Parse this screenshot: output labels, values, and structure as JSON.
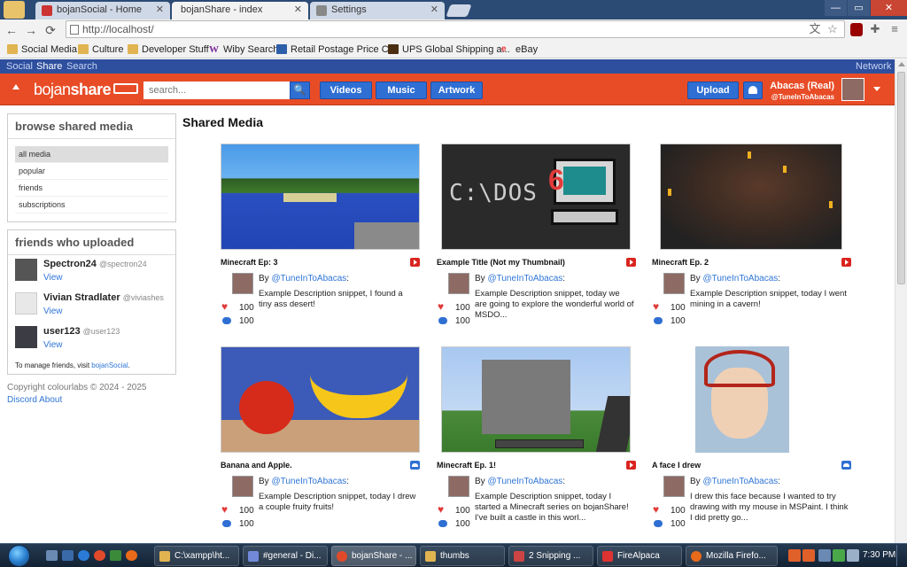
{
  "browser": {
    "tabs": [
      {
        "label": "bojanSocial - Home",
        "close": "✕"
      },
      {
        "label": "bojanShare - index",
        "close": "✕"
      },
      {
        "label": "Settings",
        "close": "✕"
      }
    ],
    "url": "http://localhost/",
    "bookmarks": [
      {
        "label": "Social Media",
        "icon": "folder-icon"
      },
      {
        "label": "Culture",
        "icon": "folder-icon"
      },
      {
        "label": "Developer Stuff",
        "icon": "folder-icon"
      },
      {
        "label": "Wiby Search",
        "icon": "wiby-icon"
      },
      {
        "label": "Retail Postage Price C...",
        "icon": "usps-icon"
      },
      {
        "label": "UPS Global Shipping a...",
        "icon": "ups-icon"
      },
      {
        "label": "eBay",
        "icon": "ebay-icon"
      }
    ],
    "window_controls": {
      "minimize": "—",
      "maximize": "▭",
      "close": "✕"
    },
    "nav": {
      "back": "←",
      "forward": "→",
      "reload": "⟳"
    }
  },
  "network_bar": {
    "social": "Social",
    "share": "Share",
    "search": "Search",
    "network": "Network"
  },
  "header": {
    "logo_light": "bojan",
    "logo_bold": "share",
    "search_placeholder": "search...",
    "search_icon": "🔍",
    "nav": [
      "Videos",
      "Music",
      "Artwork"
    ],
    "upload": "Upload",
    "user_name": "Abacas (Real)",
    "user_handle": "@TuneInToAbacas",
    "accent": "#e84c26",
    "button_blue": "#2f6fd3"
  },
  "sidebar": {
    "browse_title": "browse shared media",
    "browse_items": [
      "all media",
      "popular",
      "friends",
      "subscriptions"
    ],
    "friends_title": "friends who uploaded",
    "friends": [
      {
        "name": "Spectron24",
        "handle": "@spectron24",
        "view": "View"
      },
      {
        "name": "Vivian Stradlater",
        "handle": "@viviashes",
        "view": "View"
      },
      {
        "name": "user123",
        "handle": "@user123",
        "view": "View"
      }
    ],
    "manage_text": "To manage friends, visit ",
    "manage_link": "bojanSocial",
    "manage_end": ".",
    "copyright": "Copyright colourlabs © 2024 - 2025",
    "footer_links": [
      "Discord",
      "About"
    ]
  },
  "main": {
    "title": "Shared Media",
    "items": [
      {
        "title": "Minecraft Ep: 3",
        "type": "video",
        "by": "By ",
        "author": "@TuneInToAbacas",
        "colon": ":",
        "desc": "Example Description snippet, I found a tiny ass desert!",
        "likes": "100",
        "comments": "100",
        "heart": "♥"
      },
      {
        "title": "Example Title (Not my Thumbnail)",
        "type": "video",
        "by": "By ",
        "author": "@TuneInToAbacas",
        "colon": ":",
        "desc": "Example Description snippet, today we are going to explore the wonderful world of MSDO...",
        "likes": "100",
        "comments": "100",
        "heart": "♥",
        "thumb_text": "C:\\DOS",
        "thumb_badge": "6"
      },
      {
        "title": "Minecraft Ep. 2",
        "type": "video",
        "by": "By ",
        "author": "@TuneInToAbacas",
        "colon": ":",
        "desc": "Example Description snippet, today I went mining in a cavern!",
        "likes": "100",
        "comments": "100",
        "heart": "♥"
      },
      {
        "title": "Banana and Apple.",
        "type": "artwork",
        "by": "By ",
        "author": "@TuneInToAbacas",
        "colon": ":",
        "desc": "Example Description snippet, today I drew a couple fruity fruits!",
        "likes": "100",
        "comments": "100",
        "heart": "♥"
      },
      {
        "title": "Minecraft Ep. 1!",
        "type": "video",
        "by": "By ",
        "author": "@TuneInToAbacas",
        "colon": ":",
        "desc": "Example Description snippet, today I started a Minecraft series on bojanShare! I've built a castle in this worl...",
        "likes": "100",
        "comments": "100",
        "heart": "♥"
      },
      {
        "title": "A face I drew",
        "type": "artwork",
        "by": "By ",
        "author": "@TuneInToAbacas",
        "colon": ":",
        "desc": "I drew this face because I wanted to try drawing with my mouse in MSPaint. I think I did pretty go...",
        "likes": "100",
        "comments": "100",
        "heart": "♥"
      }
    ]
  },
  "taskbar": {
    "tasks": [
      "C:\\xampp\\ht...",
      "#general - Di...",
      "bojanShare - ...",
      "thumbs",
      "2 Snipping ...",
      "FireAlpaca",
      "Mozilla Firefo..."
    ],
    "clock": "7:30 PM"
  }
}
